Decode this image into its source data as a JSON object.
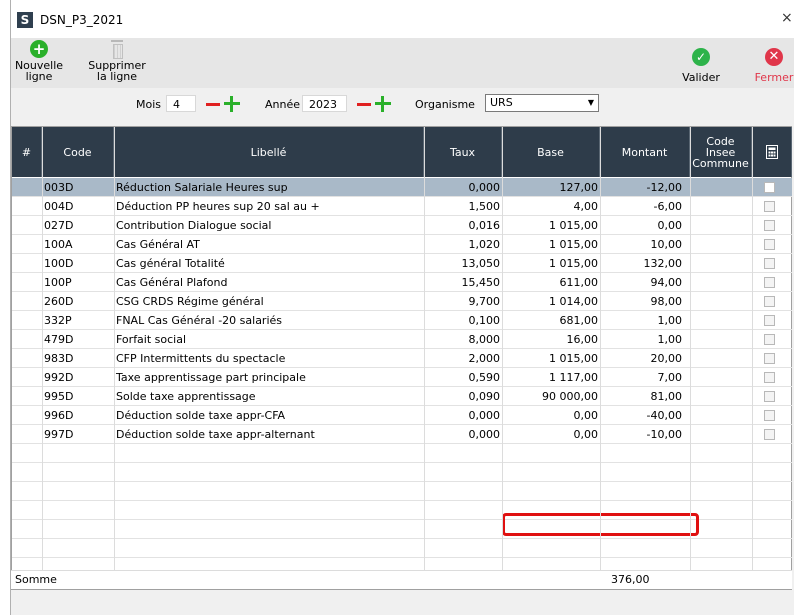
{
  "window": {
    "logo_letter": "S",
    "title": "DSN_P3_2021",
    "close_glyph": "×"
  },
  "toolbar": {
    "new_line_label_1": "Nouvelle",
    "new_line_label_2": "ligne",
    "delete_label_1": "Supprimer",
    "delete_label_2": "la ligne",
    "validate_label": "Valider",
    "close_label": "Fermer",
    "colors": {
      "new": "#2ab02a",
      "validate": "#2db34a",
      "close": "#e0364a",
      "close_text": "#e0364a"
    }
  },
  "filters": {
    "mois_label": "Mois",
    "mois_value": "4",
    "annee_label": "Année",
    "annee_value": "2023",
    "organisme_label": "Organisme",
    "organisme_value": "URS"
  },
  "table": {
    "headers": {
      "num": "#",
      "code": "Code",
      "libelle": "Libellé",
      "taux": "Taux",
      "base": "Base",
      "montant": "Montant",
      "insee_1": "Code",
      "insee_2": "Insee",
      "insee_3": "Commune",
      "calc_icon": "calculator-icon"
    },
    "rows": [
      {
        "code": "003D",
        "libelle": "Réduction Salariale Heures sup",
        "taux": "0,000",
        "base": "127,00",
        "montant": "-12,00",
        "selected": true
      },
      {
        "code": "004D",
        "libelle": "Déduction PP heures sup 20 sal au +",
        "taux": "1,500",
        "base": "4,00",
        "montant": "-6,00"
      },
      {
        "code": "027D",
        "libelle": "Contribution Dialogue social",
        "taux": "0,016",
        "base": "1 015,00",
        "montant": "0,00"
      },
      {
        "code": "100A",
        "libelle": "Cas Général AT",
        "taux": "1,020",
        "base": "1 015,00",
        "montant": "10,00"
      },
      {
        "code": "100D",
        "libelle": "Cas général Totalité",
        "taux": "13,050",
        "base": "1 015,00",
        "montant": "132,00"
      },
      {
        "code": "100P",
        "libelle": "Cas Général Plafond",
        "taux": "15,450",
        "base": "611,00",
        "montant": "94,00"
      },
      {
        "code": "260D",
        "libelle": "CSG CRDS Régime général",
        "taux": "9,700",
        "base": "1 014,00",
        "montant": "98,00"
      },
      {
        "code": "332P",
        "libelle": "FNAL Cas Général -20 salariés",
        "taux": "0,100",
        "base": "681,00",
        "montant": "1,00"
      },
      {
        "code": "479D",
        "libelle": "Forfait social",
        "taux": "8,000",
        "base": "16,00",
        "montant": "1,00"
      },
      {
        "code": "983D",
        "libelle": "CFP Intermittents du spectacle",
        "taux": "2,000",
        "base": "1 015,00",
        "montant": "20,00"
      },
      {
        "code": "992D",
        "libelle": "Taxe apprentissage part principale",
        "taux": "0,590",
        "base": "1 117,00",
        "montant": "7,00"
      },
      {
        "code": "995D",
        "libelle": "Solde taxe apprentissage",
        "taux": "0,090",
        "base": "90 000,00",
        "montant": "81,00"
      },
      {
        "code": "996D",
        "libelle": "Déduction solde taxe appr-CFA",
        "taux": "0,000",
        "base": "0,00",
        "montant": "-40,00"
      },
      {
        "code": "997D",
        "libelle": "Déduction solde taxe appr-alternant",
        "taux": "0,000",
        "base": "0,00",
        "montant": "-10,00"
      }
    ],
    "highlight_color": "#e01010"
  },
  "footer": {
    "somme_label": "Somme",
    "somme_value": "376,00"
  }
}
